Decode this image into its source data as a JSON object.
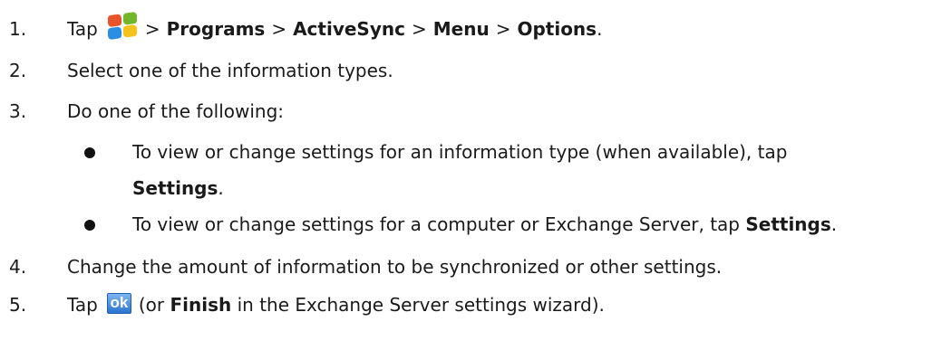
{
  "steps": [
    {
      "number": "1.",
      "tap": "Tap",
      "start_icon": "windows-start-icon",
      "sep": ">",
      "path": [
        "Programs",
        "ActiveSync",
        "Menu",
        "Options"
      ],
      "end": "."
    },
    {
      "number": "2.",
      "text": "Select one of the information types."
    },
    {
      "number": "3.",
      "text": "Do one of the following:"
    },
    {
      "number": "4.",
      "text": "Change the amount of information to be synchronized or other settings."
    },
    {
      "number": "5.",
      "tap": "Tap",
      "ok_icon": "ok-icon",
      "ok_text": "ok",
      "text_before": "(or",
      "bold": "Finish",
      "text_after": "in the Exchange Server settings wizard)."
    }
  ],
  "bullets": [
    {
      "line1": "To view or change settings for an information type (when available), tap",
      "bold": "Settings",
      "end": "."
    },
    {
      "text": "To view or change settings for a computer or Exchange Server, tap",
      "bold": "Settings",
      "end": "."
    }
  ]
}
